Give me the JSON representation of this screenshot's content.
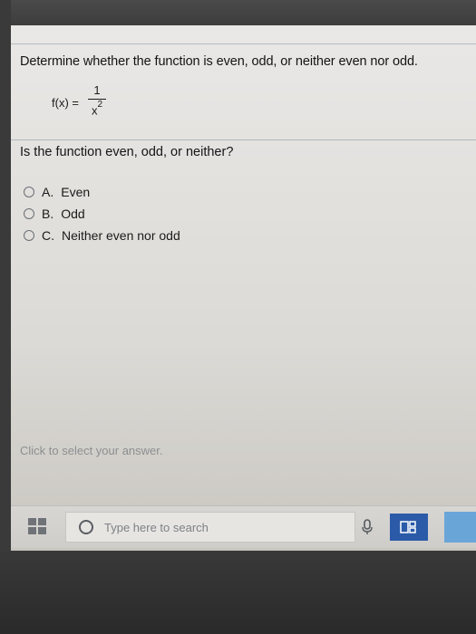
{
  "question": {
    "title": "Determine whether the function is even, odd, or neither even nor odd.",
    "formula_lhs": "f(x) =",
    "formula_numerator": "1",
    "formula_denominator": "x",
    "formula_exponent": "2",
    "prompt": "Is the function even, odd, or neither?"
  },
  "options": [
    {
      "letter": "A.",
      "label": "Even"
    },
    {
      "letter": "B.",
      "label": "Odd"
    },
    {
      "letter": "C.",
      "label": "Neither even nor odd"
    }
  ],
  "hint": "Click to select your answer.",
  "taskbar": {
    "search_placeholder": "Type here to search",
    "start_icon": "windows-logo-icon",
    "mic_icon": "microphone-icon",
    "taskview_icon": "task-view-icon"
  },
  "colors": {
    "taskbar_accent": "#2b5aa8",
    "edge_accent": "#6aa5d8"
  }
}
